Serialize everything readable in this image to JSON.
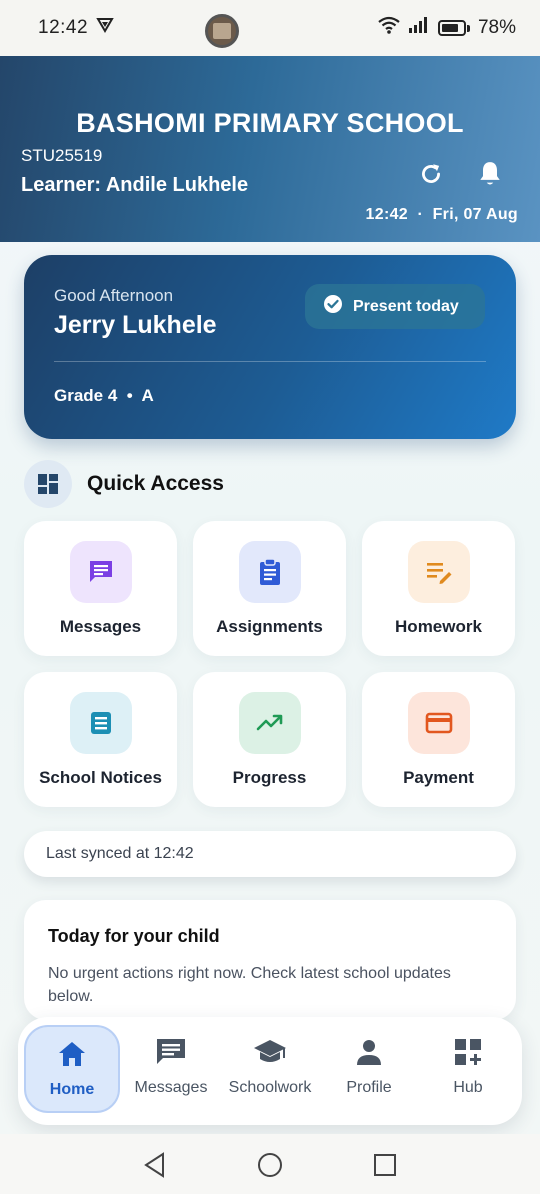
{
  "status_bar": {
    "time": "12:42",
    "battery": "78%"
  },
  "header": {
    "school_name": "BASHOMI PRIMARY SCHOOL",
    "student_id": "STU25519",
    "learner": "Learner: Andile Lukhele",
    "time": "12:42",
    "separator": "·",
    "date": "Fri, 07 Aug"
  },
  "greeting": {
    "label": "Good Afternoon",
    "name": "Jerry Lukhele",
    "status": "Present today",
    "grade": "Grade 4",
    "dot": "•",
    "class": "A"
  },
  "quick_access": {
    "title": "Quick Access",
    "items": [
      {
        "label": "Messages",
        "icon": "chat-icon",
        "color": "#7b3fe4",
        "bg": "#eee4fd"
      },
      {
        "label": "Assignments",
        "icon": "clipboard-icon",
        "color": "#2f5bd6",
        "bg": "#e2e8fb"
      },
      {
        "label": "Homework",
        "icon": "edit-note-icon",
        "color": "#e08a1e",
        "bg": "#fdeede"
      },
      {
        "label": "School Notices",
        "icon": "document-icon",
        "color": "#1c8fb4",
        "bg": "#ddf0f6"
      },
      {
        "label": "Progress",
        "icon": "trending-up-icon",
        "color": "#1f9a55",
        "bg": "#dcf1e5"
      },
      {
        "label": "Payment",
        "icon": "card-icon",
        "color": "#e2571f",
        "bg": "#fde5db"
      }
    ]
  },
  "sync": {
    "text": "Last synced at 12:42"
  },
  "today": {
    "title": "Today for your child",
    "body": "No urgent actions right now. Check latest school updates below."
  },
  "bottom_nav": {
    "items": [
      {
        "label": "Home",
        "icon": "home-icon",
        "active": true
      },
      {
        "label": "Messages",
        "icon": "message-icon"
      },
      {
        "label": "Schoolwork",
        "icon": "graduation-cap-icon"
      },
      {
        "label": "Profile",
        "icon": "person-icon"
      },
      {
        "label": "Hub",
        "icon": "apps-add-icon"
      }
    ]
  }
}
